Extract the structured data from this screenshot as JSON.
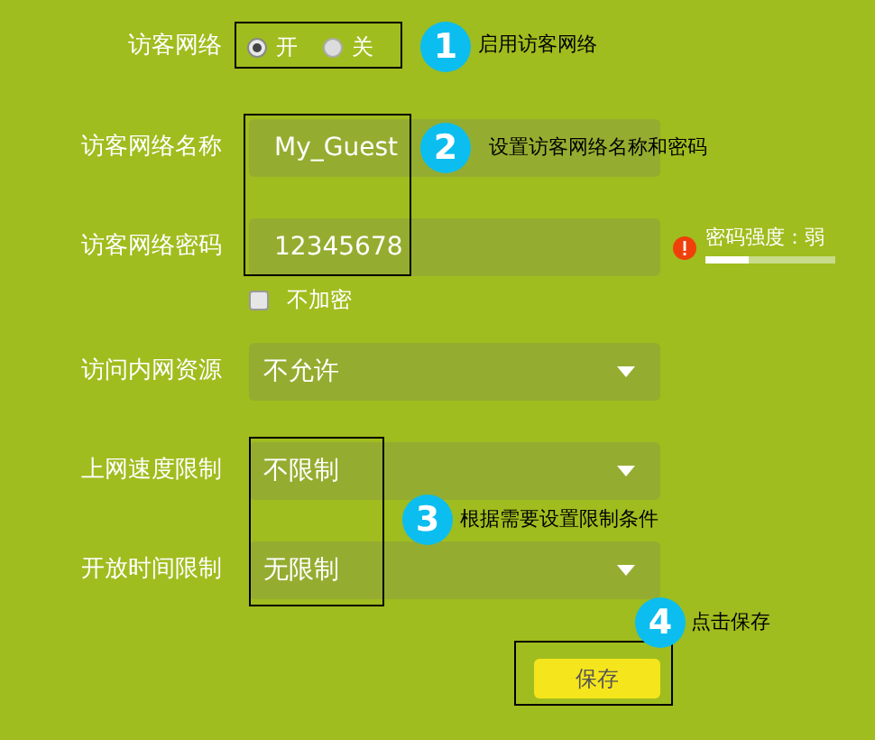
{
  "guest_network": {
    "label": "访客网络",
    "options": [
      {
        "label": "开",
        "selected": true
      },
      {
        "label": "关",
        "selected": false
      }
    ]
  },
  "network_name": {
    "label": "访客网络名称",
    "value": "My_Guest"
  },
  "network_password": {
    "label": "访客网络密码",
    "value": "12345678",
    "strength_label": "密码强度：弱",
    "level": 0.33
  },
  "no_encryption": {
    "label": "不加密",
    "checked": false
  },
  "selects": [
    {
      "label": "访问内网资源",
      "value": "不允许"
    },
    {
      "label": "上网速度限制",
      "value": "不限制"
    },
    {
      "label": "开放时间限制",
      "value": "无限制"
    }
  ],
  "save_button": "保存",
  "annotations": [
    {
      "number": "1",
      "text": "启用访客网络"
    },
    {
      "number": "2",
      "text": "设置访客网络名称和密码"
    },
    {
      "number": "3",
      "text": "根据需要设置限制条件"
    },
    {
      "number": "4",
      "text": "点击保存"
    }
  ]
}
